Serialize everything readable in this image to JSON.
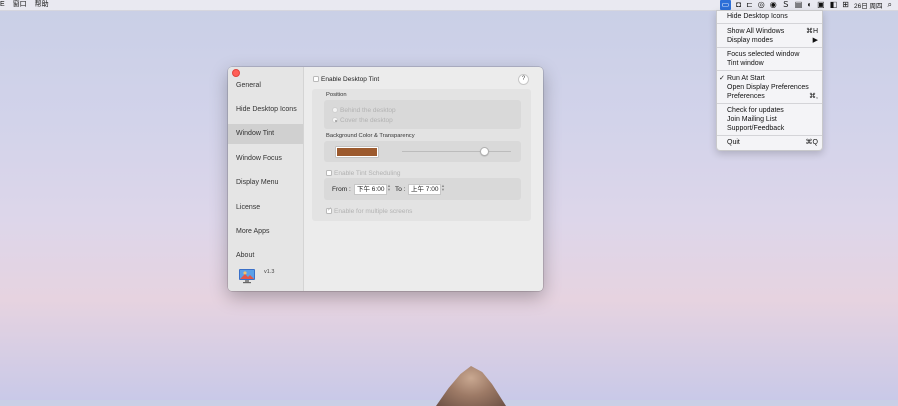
{
  "menubar": {
    "left_items": [
      "E",
      "窗口",
      "帮助"
    ],
    "right_icons": [
      "monitor-icon",
      "camera-icon",
      "screen-record-icon",
      "chat-icon",
      "message-icon",
      "s-icon",
      "app-icon",
      "app-icon",
      "app-icon",
      "app-icon",
      "app-icon"
    ],
    "clock": "26日 周四",
    "search_icon": "search-icon"
  },
  "dropdown": {
    "items": [
      {
        "label": "Hide Desktop Icons",
        "shortcut": ""
      },
      {
        "label": "Show All Windows",
        "shortcut": "⌘H"
      },
      {
        "label": "Display modes",
        "shortcut": "▶"
      },
      {
        "label": "Focus selected window",
        "shortcut": ""
      },
      {
        "label": "Tint window",
        "shortcut": ""
      },
      {
        "label": "Run At Start",
        "shortcut": "",
        "checked": true
      },
      {
        "label": "Open Display Preferences",
        "shortcut": ""
      },
      {
        "label": "Preferences",
        "shortcut": "⌘,"
      },
      {
        "label": "Check for updates",
        "shortcut": ""
      },
      {
        "label": "Join Mailing List",
        "shortcut": ""
      },
      {
        "label": "Support/Feedback",
        "shortcut": ""
      },
      {
        "label": "Quit",
        "shortcut": "⌘Q"
      }
    ]
  },
  "window": {
    "sidebar": {
      "items": [
        "General",
        "Hide Desktop Icons",
        "Window Tint",
        "Window Focus",
        "Display Menu",
        "License",
        "More Apps",
        "About"
      ],
      "selected": "Window Tint",
      "version": "v1.3"
    },
    "content": {
      "enable_tint_label": "Enable Desktop Tint",
      "help_label": "?",
      "position_title": "Position",
      "behind_desktop_label": "Behind the desktop",
      "cover_desktop_label": "Cover the desktop",
      "bg_title": "Background Color & Transparency",
      "tint_color": "#9c5a2e",
      "transparency_value": 0.75,
      "scheduling_label": "Enable Tint Scheduling",
      "from_label": "From :",
      "from_time": "下午  6:00",
      "to_label": "To :",
      "to_time": "上午  7:00",
      "multiple_screens_label": "Enable for multiple screens"
    }
  }
}
